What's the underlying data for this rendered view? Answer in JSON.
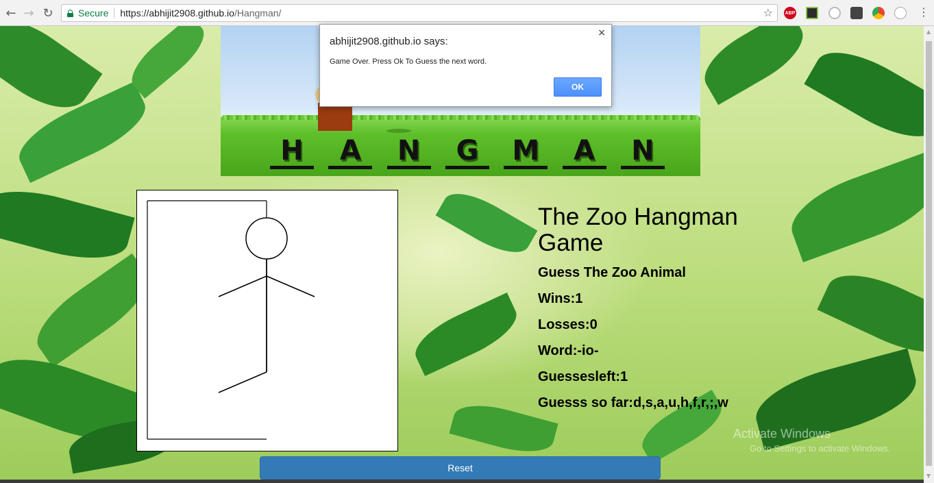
{
  "browser": {
    "secure_label": "Secure",
    "url_host": "https://abhijit2908.github.io",
    "url_path": "/Hangman/",
    "extensions": [
      "abp-icon",
      "checkmark-icon",
      "circle-icon",
      "bulb-icon",
      "chrome-color-icon",
      "grey-circle-icon"
    ]
  },
  "banner": {
    "letters": [
      "H",
      "A",
      "N",
      "G",
      "M",
      "A",
      "N"
    ]
  },
  "game": {
    "title": "The Zoo Hangman Game",
    "subtitle": "Guess The Zoo Animal",
    "wins": "Wins:1",
    "losses": "Losses:0",
    "word": "Word:-io-",
    "guesses_left": "Guessesleft:1",
    "guessed_so_far": "Guesss so far:d,s,a,u,h,f,r,;,w",
    "reset_label": "Reset"
  },
  "dialog": {
    "title": "abhijit2908.github.io says:",
    "message": "Game Over. Press Ok To Guess the next word.",
    "ok_label": "OK"
  },
  "watermark": {
    "line1": "Activate Windows",
    "line2": "Go to Settings to activate Windows."
  },
  "colors": {
    "reset_button": "#337ab7",
    "secure_green": "#0b8043",
    "dialog_ok": "#4d8ffb"
  }
}
